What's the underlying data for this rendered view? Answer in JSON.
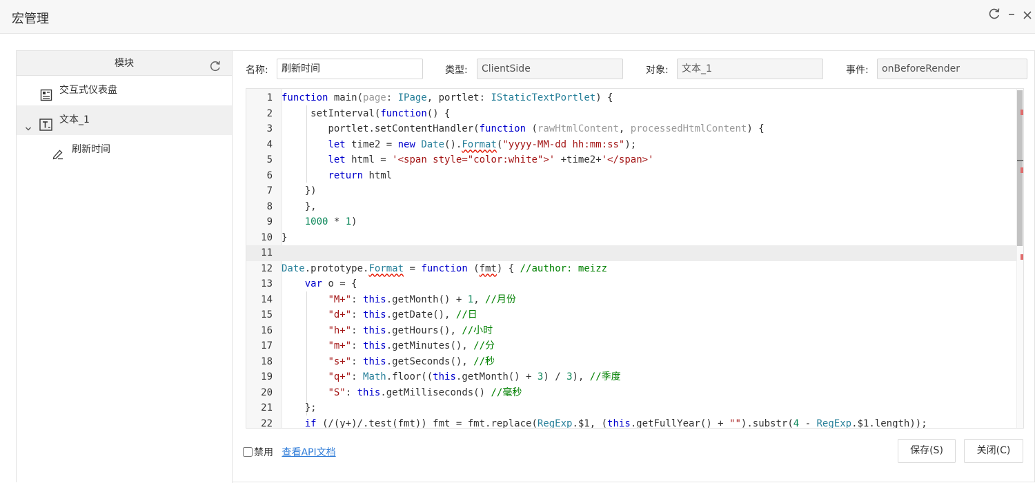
{
  "window": {
    "title": "宏管理"
  },
  "sidebar": {
    "header": "模块",
    "items": [
      {
        "label": "交互式仪表盘",
        "icon": "dashboard-icon"
      },
      {
        "label": "文本_1",
        "icon": "text-box-icon"
      },
      {
        "label": "刷新时间",
        "icon": "edit-pen-icon"
      }
    ]
  },
  "form": {
    "name_label": "名称:",
    "name_value": "刷新时间",
    "type_label": "类型:",
    "type_value": "ClientSide",
    "object_label": "对象:",
    "object_value": "文本_1",
    "event_label": "事件:",
    "event_value": "onBeforeRender"
  },
  "editor": {
    "line_numbers": [
      "1",
      "2",
      "3",
      "4",
      "5",
      "6",
      "7",
      "8",
      "9",
      "10",
      "11",
      "12",
      "13",
      "14",
      "15",
      "16",
      "17",
      "18",
      "19",
      "20",
      "21",
      "22"
    ],
    "tokens": {
      "kw_function": "function",
      "main": " main(",
      "page": "page",
      "colon1": ": ",
      "IPage": "IPage",
      "comma_portlet": ", portlet: ",
      "IStatic": "IStaticTextPortlet",
      "l1_end": ") {",
      "setInterval": "setInterval(",
      "fn2": "function",
      "l2_end": "() {",
      "l3_a": "portlet.setContentHandler(",
      "fn3": "function",
      "l3_b": " (",
      "rawHtml": "rawHtmlContent",
      "comma": ", ",
      "processed": "processedHtmlContent",
      "l3_end": ") {",
      "let": "let",
      "time2_eq": " time2 = ",
      "new": "new",
      "Date": " Date",
      "paren_dot": "().",
      "Format": "Format",
      "lp": "(",
      "fmtstr": "\"yyyy-MM-dd hh:mm:ss\"",
      "rp_semi": ");",
      "let2": "let",
      "html_eq": " html = ",
      "spanstr": "'<span style=\"color:white\">'",
      "plus_time2": " +time2+",
      "endspan": "'</span>'",
      "return": "return",
      "html": " html",
      "close1": "})",
      "close2": "},",
      "n1000": "1000",
      "times": " * ",
      "n1": "1",
      "rp": ")",
      "rbrace": "}",
      "DateP": "Date",
      "proto": ".prototype.",
      "Format2": "Format",
      "eq": " = ",
      "fn12": "function",
      "fmt_open": " (",
      "fmt": "fmt",
      "l12_end": ") { ",
      "author": "//author: meizz",
      "var": "var",
      "o_eq": " o = {",
      "kM": "\"M+\"",
      "colon": ": ",
      "this": "this",
      "getMonth1": ".getMonth() + ",
      "num1": "1",
      "comma_sp": ", ",
      "cMonth": "//月份",
      "kd": "\"d+\"",
      "getDate": ".getDate(), ",
      "cDay": "//日",
      "kh": "\"h+\"",
      "getHours": ".getHours(), ",
      "cHour": "//小时",
      "km": "\"m+\"",
      "getMinutes": ".getMinutes(), ",
      "cMin": "//分",
      "ks": "\"s+\"",
      "getSeconds": ".getSeconds(), ",
      "cSec": "//秒",
      "kq": "\"q+\"",
      "Math": "Math",
      "floor": ".floor((",
      "getMonth3": ".getMonth() + ",
      "num3": "3",
      "div": ") / ",
      "num3b": "3",
      "rp_comma": "), ",
      "cQuarter": "//季度",
      "kS": "\"S\"",
      "getMs": ".getMilliseconds() ",
      "cMs": "//毫秒",
      "close21": "};",
      "if": "if",
      "l22_a": " (/(y+)/.test(fmt)) fmt = fmt.replace(",
      "RegExp1": "RegExp",
      "l22_b": ".$1, (",
      "this22": "this",
      "l22_c": ".getFullYear() + ",
      "emptystr": "\"\"",
      "l22_d": ").substr(",
      "num4": "4",
      "l22_e": " - ",
      "RegExp2": "RegExp",
      "l22_f": ".$1.length));"
    }
  },
  "footer": {
    "disable_label": "禁用",
    "api_link": "查看API文档",
    "save_button": "保存(S)",
    "close_button": "关闭(C)"
  }
}
